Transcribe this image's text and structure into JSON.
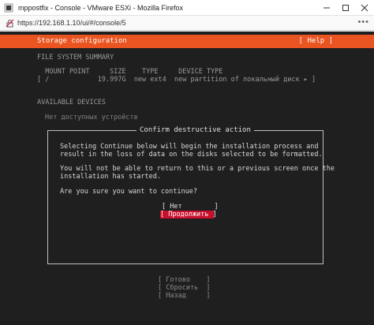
{
  "window": {
    "title": "mppostfix - Console - VMware ESXi - Mozilla Firefox"
  },
  "urlbar": {
    "url": "https://192.168.1.10/ui/#/console/5",
    "menu_glyph": "•••"
  },
  "header": {
    "title": "Storage configuration",
    "help": "[ Help ]"
  },
  "fs_summary": {
    "heading": "FILE SYSTEM SUMMARY",
    "columns_line": "  MOUNT POINT     SIZE    TYPE     DEVICE TYPE",
    "row_line": "[ /            19.997G  new ext4  new partition of локальный диск ▸ ]"
  },
  "available_devices": {
    "heading": "AVAILABLE DEVICES",
    "empty_text": "Нет доступных устройств"
  },
  "dialog": {
    "title": "Confirm destructive action",
    "lines": [
      "Selecting Continue below will begin the installation process and",
      "result in the loss of data on the disks selected to be formatted.",
      "You will not be able to return to this or a previous screen once the",
      "installation has started.",
      "Are you sure you want to continue?"
    ],
    "no_button": "[ Нет        ]",
    "continue_button": "[ Продолжить ]"
  },
  "bottom_buttons": {
    "done": "[ Готово    ]",
    "reset": "[ Сбросить  ]",
    "back": "[ Назад     ]"
  }
}
